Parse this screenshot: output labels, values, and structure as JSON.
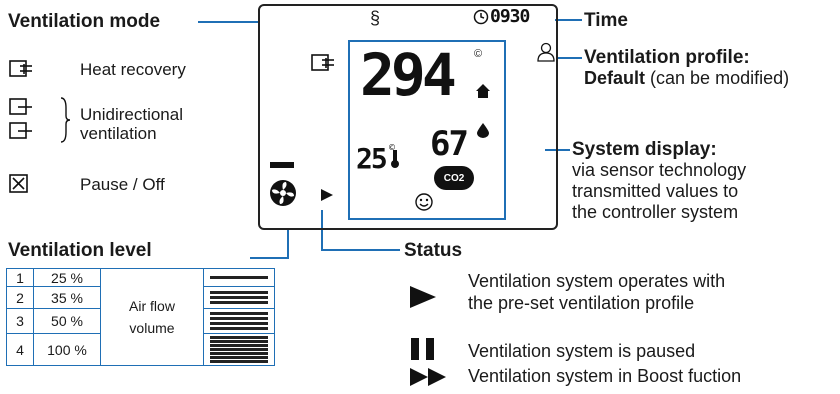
{
  "labels": {
    "ventilation_mode": "Ventilation mode",
    "time": "Time",
    "ventilation_profile": "Ventilation profile:",
    "profile_default_bold": "Default",
    "profile_default_rest": "(can be modified)",
    "system_display": "System display:",
    "system_display_desc": [
      "via sensor technology",
      "transmitted values to",
      "the controller system"
    ],
    "ventilation_level": "Ventilation level",
    "status": "Status"
  },
  "modes": [
    {
      "label": "Heat recovery",
      "icon": "heat-recovery-icon"
    },
    {
      "label": "Unidirectional",
      "label2": "ventilation",
      "icon": "unidirectional-icon"
    },
    {
      "label": "Pause / Off",
      "icon": "pause-off-icon"
    }
  ],
  "display": {
    "time": "0930",
    "main_value": "294",
    "temp_value": "25",
    "humidity_value": "67",
    "co2_label": "CO2"
  },
  "levels": {
    "rows": [
      {
        "level": "1",
        "percent": "25 %",
        "bars": 1
      },
      {
        "level": "2",
        "percent": "35 %",
        "bars": 3
      },
      {
        "level": "3",
        "percent": "50 %",
        "bars": 4
      },
      {
        "level": "4",
        "percent": "100 %",
        "bars": 7
      }
    ],
    "airflow_line1": "Air flow",
    "airflow_line2": "volume"
  },
  "status_items": [
    {
      "icon": "play-icon",
      "line1": "Ventilation system operates with",
      "line2": "the pre-set ventilation profile"
    },
    {
      "icon": "pause-icon",
      "line1": "Ventilation system is paused"
    },
    {
      "icon": "boost-icon",
      "line1": "Ventilation system in Boost fuction"
    }
  ],
  "colors": {
    "accent": "#1f6fb5",
    "text": "#1a1a1a"
  }
}
